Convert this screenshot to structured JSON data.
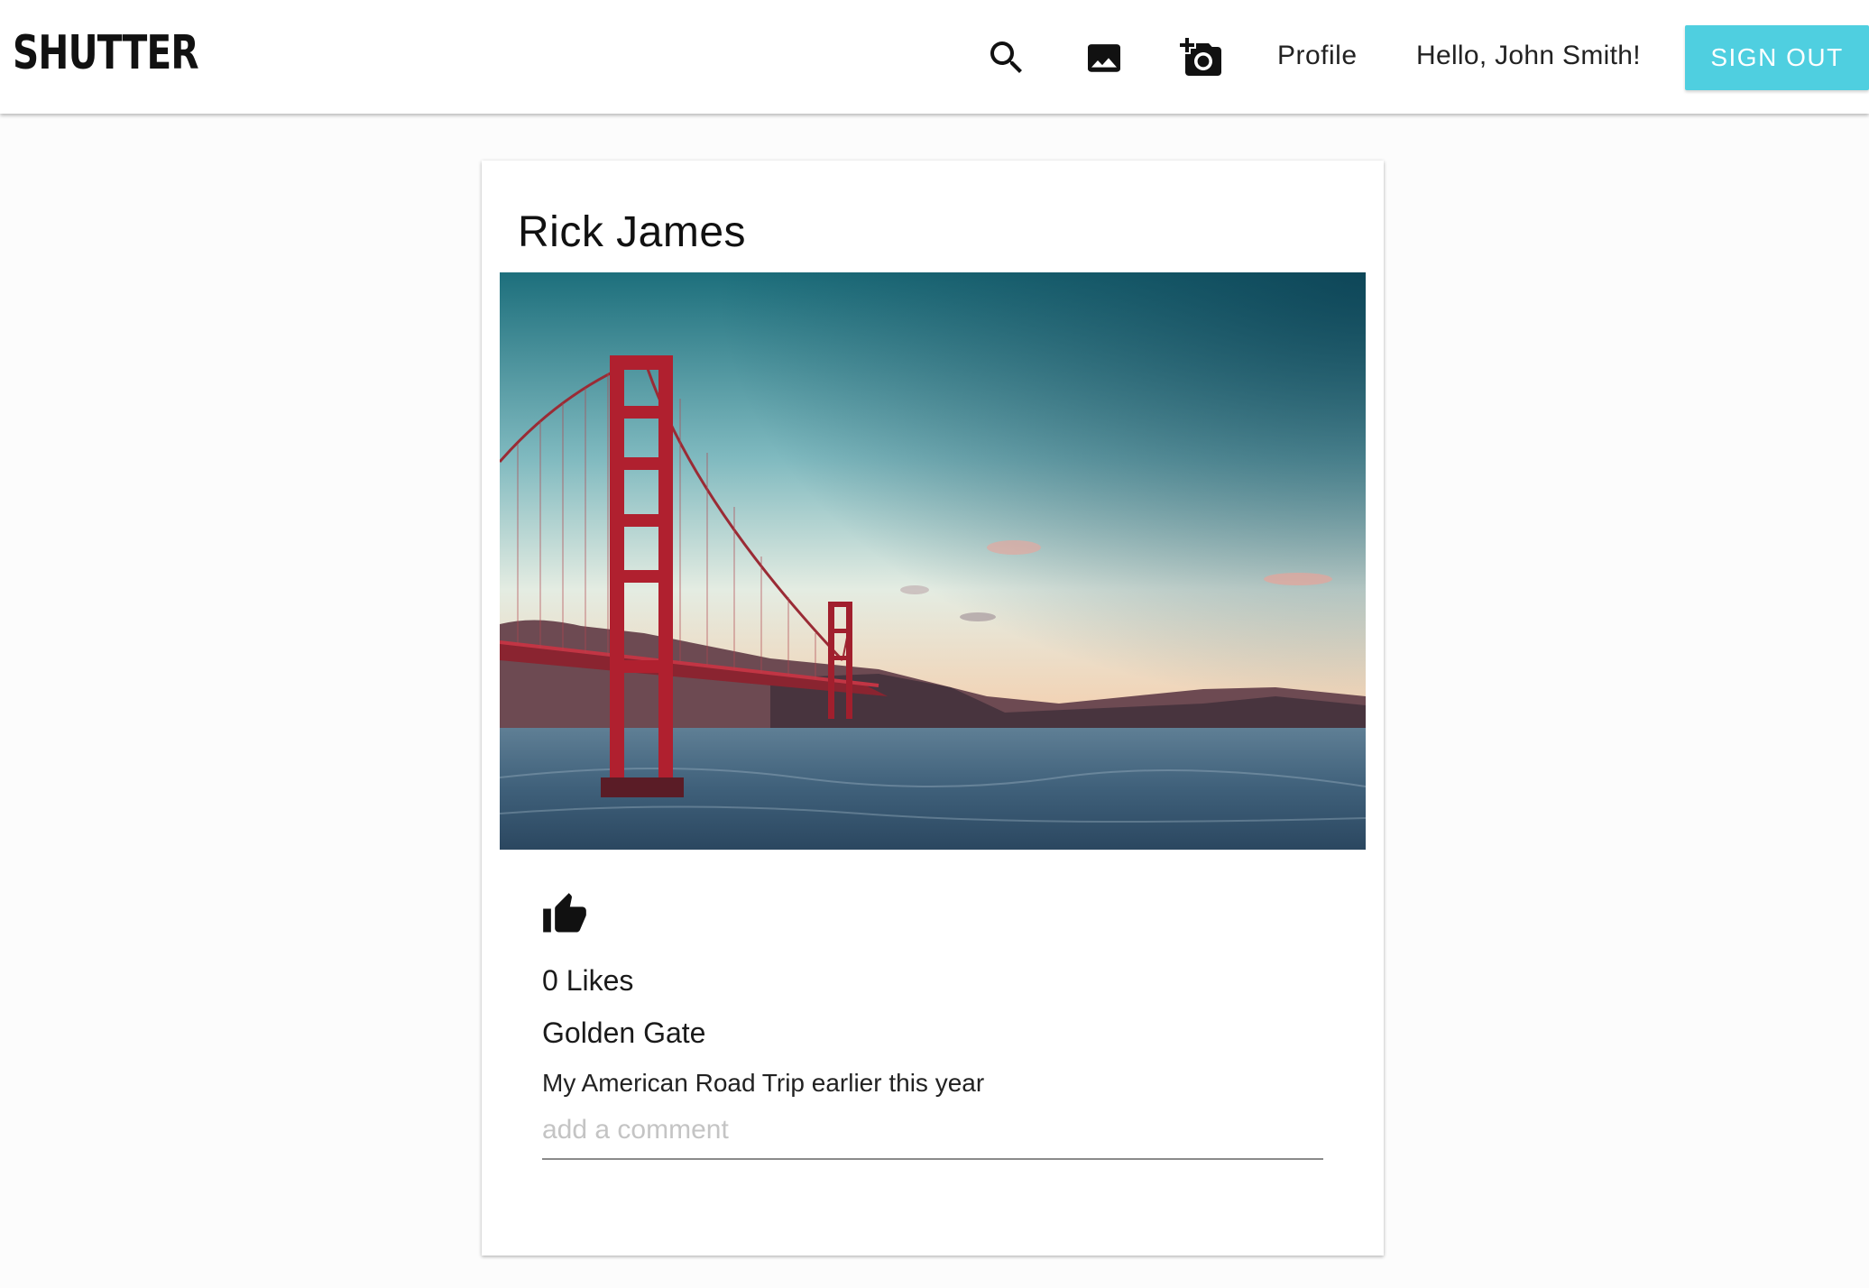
{
  "app": {
    "brand": "SHUTTER",
    "accent_color": "#4fcfe0"
  },
  "navbar": {
    "icons": [
      "search-icon",
      "photo-gallery-icon",
      "add-photo-icon"
    ],
    "profile_label": "Profile",
    "greeting": "Hello, John Smith!",
    "signout_label": "SIGN OUT"
  },
  "post": {
    "author": "Rick James",
    "image_subject": "Golden Gate Bridge at sunset",
    "like_icon": "thumbs-up-icon",
    "likes_text": "0 Likes",
    "title": "Golden Gate",
    "caption": "My American Road Trip earlier this year",
    "comment_placeholder": "add a comment"
  }
}
